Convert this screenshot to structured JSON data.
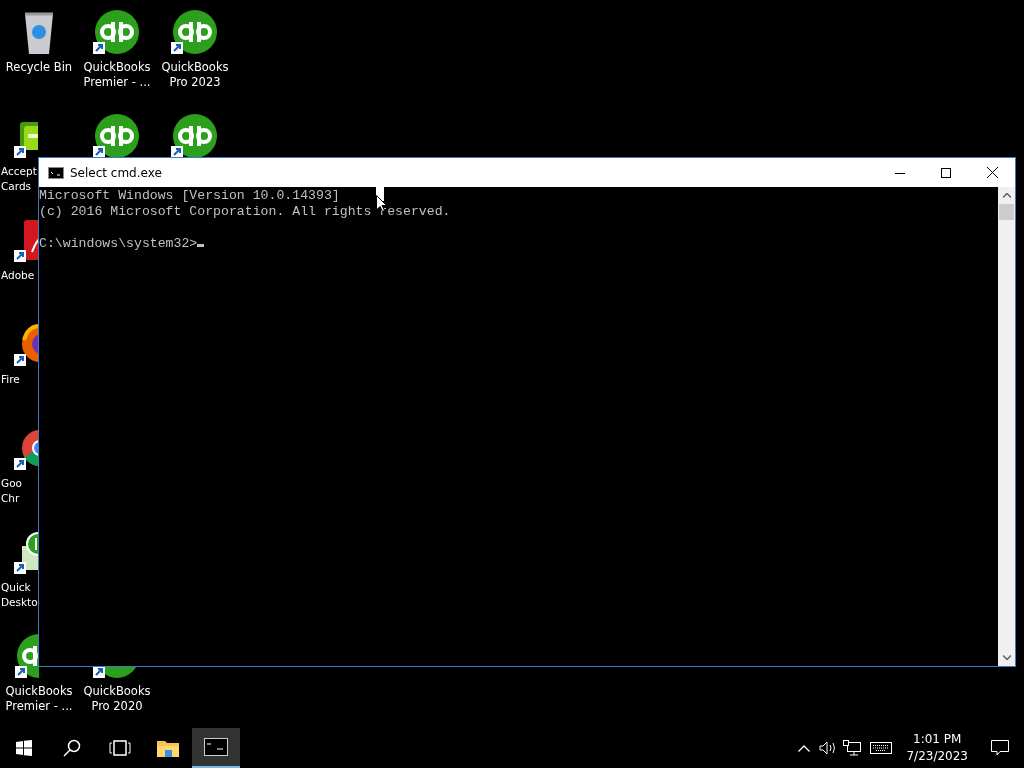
{
  "desktop_icons": [
    {
      "kind": "recycle",
      "lines": [
        "Recycle Bin"
      ]
    },
    {
      "kind": "cards",
      "lines": [
        "Accept",
        "Cards"
      ]
    },
    {
      "kind": "adobe",
      "lines": [
        "Adobe"
      ]
    },
    {
      "kind": "firefox",
      "lines": [
        "Fire"
      ]
    },
    {
      "kind": "chrome",
      "lines": [
        "Goo",
        "Chr"
      ]
    },
    {
      "kind": "qbdesktop",
      "lines": [
        "Quick",
        "Deskto"
      ]
    },
    {
      "kind": "quickbooks",
      "lines": [
        "QuickBooks",
        "Premier - ..."
      ]
    },
    {
      "kind": "quickbooks",
      "lines": [
        "QuickBooks",
        "Premier - ..."
      ]
    },
    {
      "kind": "quickbooks"
    },
    {
      "kind": "quickbooks",
      "lines": [
        "QuickBooks",
        "Pro 2020"
      ]
    },
    {
      "kind": "quickbooks",
      "lines": [
        "QuickBooks",
        "Pro 2023"
      ]
    },
    {
      "kind": "quickbooks"
    }
  ],
  "window": {
    "title": "Select cmd.exe",
    "output_lines": [
      "Microsoft Windows [Version 10.0.14393]",
      "(c) 2016 Microsoft Corporation. All rights reserved."
    ],
    "prompt": "C:\\windows\\system32>"
  },
  "taskbar": {
    "apps": [
      {
        "kind": "explorer",
        "selected": false
      },
      {
        "kind": "cmd",
        "selected": true
      }
    ],
    "time": "1:01 PM",
    "date": "7/23/2023"
  }
}
